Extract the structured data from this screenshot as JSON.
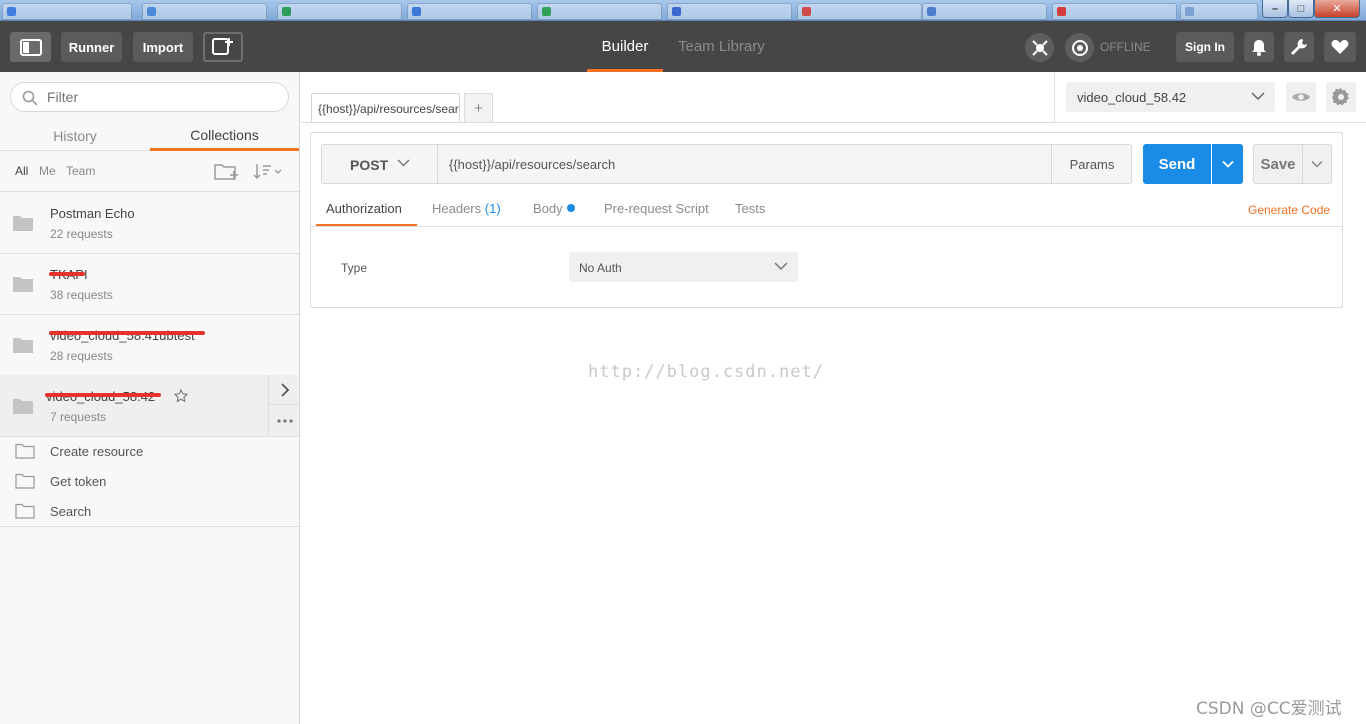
{
  "window": {
    "browser_tabs": [
      {
        "color": "#3f7be0"
      },
      {
        "color": "#4a8ad6"
      },
      {
        "color": "#2f9c5a"
      },
      {
        "color": "#3b79d9"
      },
      {
        "color": "#2fa05a"
      },
      {
        "color": "#3a66d0"
      },
      {
        "color": "#d14a4a"
      },
      {
        "color": "#4f7ecf"
      },
      {
        "color": "#cf3d3d"
      },
      {
        "color": "#7a9fd0"
      }
    ],
    "controls": {
      "minimize": "–",
      "maximize": "□",
      "close": "✕"
    }
  },
  "header": {
    "runner_label": "Runner",
    "import_label": "Import",
    "builder_label": "Builder",
    "team_library_label": "Team Library",
    "offline_label": "OFFLINE",
    "signin_label": "Sign In"
  },
  "sidebar": {
    "filter_placeholder": "Filter",
    "history_label": "History",
    "collections_label": "Collections",
    "scope": {
      "all": "All",
      "me": "Me",
      "team": "Team"
    },
    "collections": [
      {
        "name": "Postman Echo",
        "count": "22 requests",
        "redacted": false
      },
      {
        "name": "TKAPI",
        "count": "38 requests",
        "redacted": true
      },
      {
        "name": "video_cloud_58.41ubtest",
        "count": "28 requests",
        "redacted": true
      },
      {
        "name": "video_cloud_58.42",
        "count": "7 requests",
        "redacted": true
      }
    ],
    "requests": [
      {
        "label": "Create resource"
      },
      {
        "label": "Get token"
      },
      {
        "label": "Search"
      }
    ]
  },
  "main": {
    "request_tab_label": "{{host}}/api/resources/search",
    "add_tab_label": "+",
    "environment": "video_cloud_58.42",
    "method": "POST",
    "url": "{{host}}/api/resources/search",
    "params_label": "Params",
    "send_label": "Send",
    "save_label": "Save",
    "subtabs": {
      "authorization": "Authorization",
      "headers": "Headers",
      "headers_count": "(1)",
      "body": "Body",
      "prerequest": "Pre-request Script",
      "tests": "Tests"
    },
    "generate_code_label": "Generate Code",
    "auth_type_label": "Type",
    "auth_type_value": "No Auth"
  },
  "watermark": "http://blog.csdn.net/",
  "corner_watermark": "CSDN @CC爱测试",
  "colors": {
    "accent": "#f47023",
    "primary": "#1a8be6",
    "header_bg": "#464646"
  }
}
